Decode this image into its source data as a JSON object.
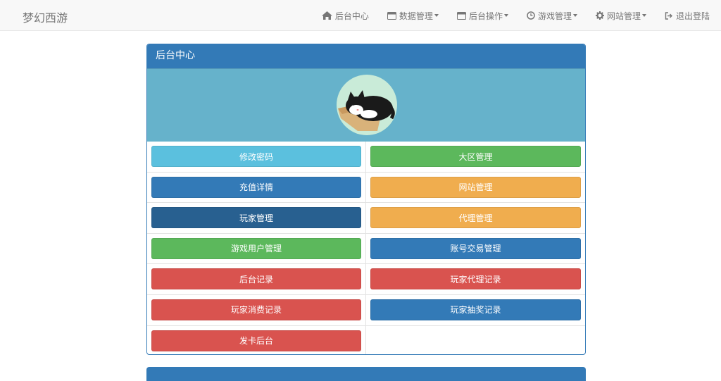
{
  "navbar": {
    "brand": "梦幻西游",
    "items": [
      {
        "label": "后台中心",
        "icon": "home-icon",
        "dropdown": false
      },
      {
        "label": "数据管理",
        "icon": "window-icon",
        "dropdown": true
      },
      {
        "label": "后台操作",
        "icon": "window-icon",
        "dropdown": true
      },
      {
        "label": "游戏管理",
        "icon": "clock-icon",
        "dropdown": true
      },
      {
        "label": "网站管理",
        "icon": "gear-icon",
        "dropdown": true
      },
      {
        "label": "退出登陆",
        "icon": "logout-icon",
        "dropdown": false
      }
    ]
  },
  "panel": {
    "title": "后台中心",
    "avatar_icon": "cat-avatar-icon",
    "buttons": [
      {
        "label": "修改密码",
        "style": "info"
      },
      {
        "label": "大区管理",
        "style": "success"
      },
      {
        "label": "充值详情",
        "style": "primary"
      },
      {
        "label": "网站管理",
        "style": "warning"
      },
      {
        "label": "玩家管理",
        "style": "dark"
      },
      {
        "label": "代理管理",
        "style": "warning"
      },
      {
        "label": "游戏用户管理",
        "style": "success"
      },
      {
        "label": "账号交易管理",
        "style": "primary"
      },
      {
        "label": "后台记录",
        "style": "danger"
      },
      {
        "label": "玩家代理记录",
        "style": "danger"
      },
      {
        "label": "玩家消费记录",
        "style": "danger"
      },
      {
        "label": "玩家抽奖记录",
        "style": "primary"
      },
      {
        "label": "发卡后台",
        "style": "danger"
      }
    ]
  },
  "colors": {
    "primary": "#337ab7",
    "banner": "#66b2cb",
    "info": "#5bc0de",
    "success": "#5cb85c",
    "warning": "#f0ad4e",
    "danger": "#d9534f"
  }
}
